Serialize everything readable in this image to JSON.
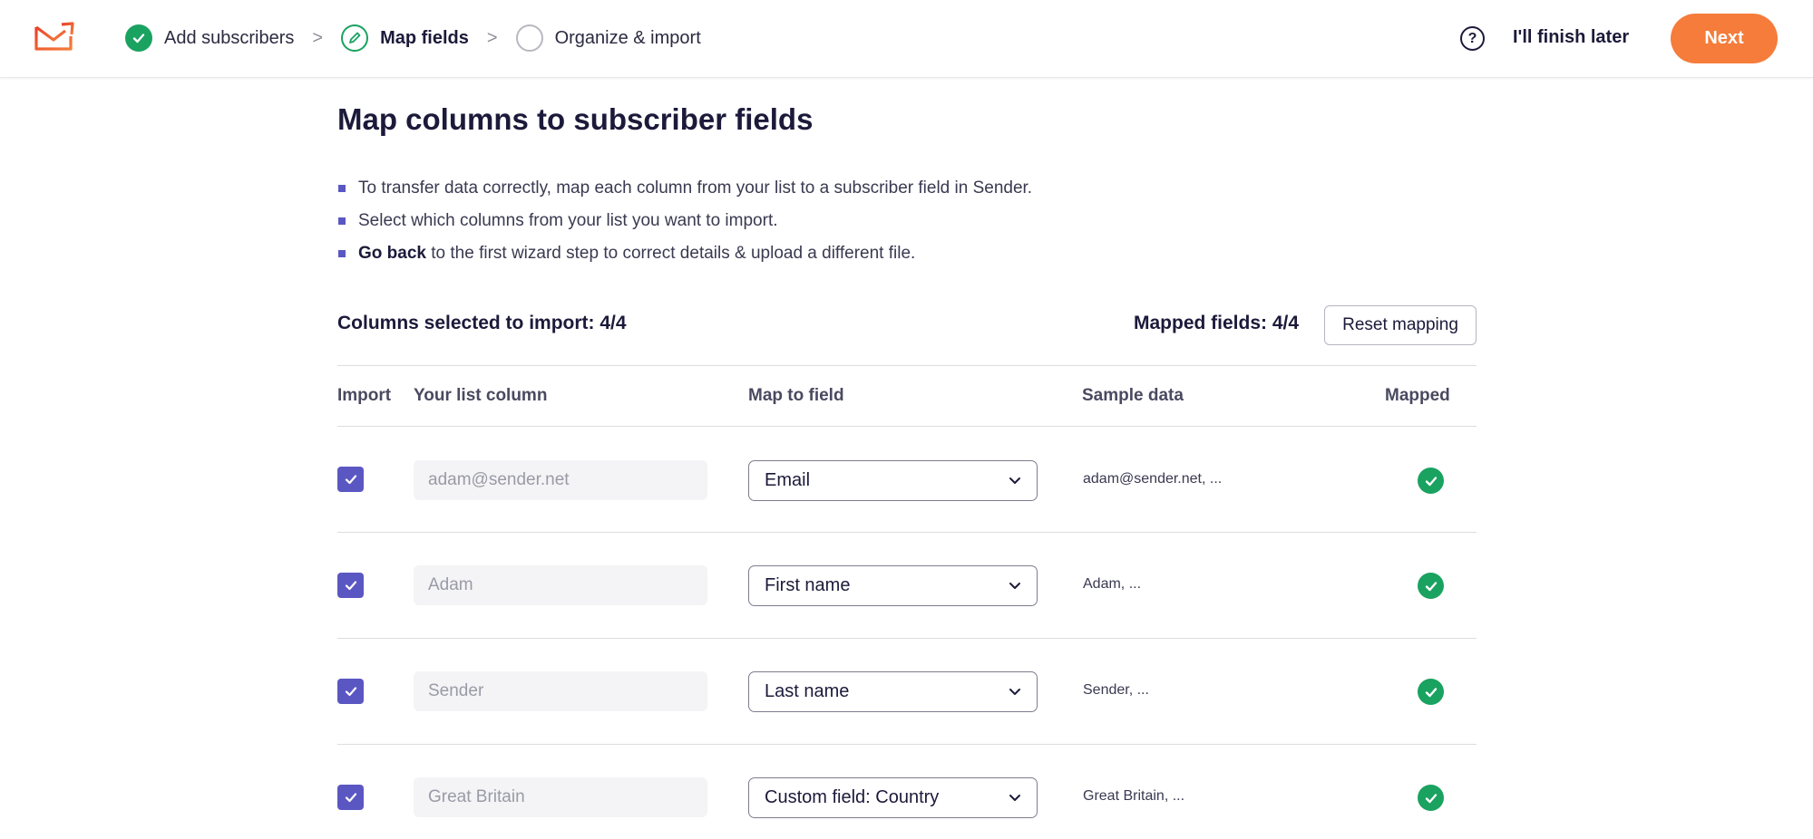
{
  "header": {
    "logo": "envelope-logo",
    "steps": [
      {
        "label": "Add subscribers",
        "state": "done"
      },
      {
        "label": "Map fields",
        "state": "current"
      },
      {
        "label": "Organize & import",
        "state": "todo"
      }
    ],
    "separator": ">",
    "help_icon": "?",
    "finish_later": "I'll finish later",
    "next": "Next"
  },
  "main": {
    "title": "Map columns to subscriber fields",
    "bullets": [
      {
        "bold": "",
        "text": "To transfer data correctly, map each column from your list to a subscriber field in Sender."
      },
      {
        "bold": "",
        "text": "Select which columns from your list you want to import."
      },
      {
        "bold": "Go back",
        "text": " to the first wizard step to correct details & upload a different file."
      }
    ],
    "columns_selected": "Columns selected to import: 4/4",
    "mapped_fields": "Mapped fields: 4/4",
    "reset_mapping": "Reset mapping"
  },
  "table": {
    "headers": {
      "import": "Import",
      "list_column": "Your list column",
      "map_to_field": "Map to field",
      "sample": "Sample data",
      "mapped": "Mapped"
    },
    "rows": [
      {
        "checked": true,
        "column": "adam@sender.net",
        "field": "Email",
        "sample": "adam@sender.net, ...",
        "mapped": true
      },
      {
        "checked": true,
        "column": "Adam",
        "field": "First name",
        "sample": "Adam, ...",
        "mapped": true
      },
      {
        "checked": true,
        "column": "Sender",
        "field": "Last name",
        "sample": "Sender, ...",
        "mapped": true
      },
      {
        "checked": true,
        "column": "Great Britain",
        "field": "Custom field: Country",
        "sample": "Great Britain, ...",
        "mapped": true
      }
    ]
  },
  "colors": {
    "accent_purple": "#5b57c2",
    "success_green": "#1aa260",
    "next_orange": "#f57c3a",
    "logo_red": "#e8412c"
  }
}
